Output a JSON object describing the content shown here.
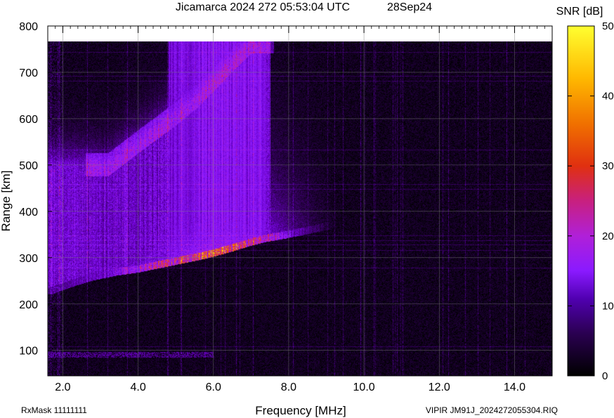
{
  "chart_data": {
    "type": "heatmap",
    "title": "Jicamarca 2024 272 05:53:04 UTC",
    "date_label": "28Sep24",
    "xlabel": "Frequency [MHz]",
    "ylabel": "Range [km]",
    "colorbar_label": "SNR [dB]",
    "xlim": [
      1.6,
      15.0
    ],
    "ylim": [
      45,
      800
    ],
    "x_ticks": [
      {
        "value": 2.0,
        "label": "2.0"
      },
      {
        "value": 4.0,
        "label": "4.0"
      },
      {
        "value": 6.0,
        "label": "6.0"
      },
      {
        "value": 8.0,
        "label": "8.0"
      },
      {
        "value": 10.0,
        "label": "10.0"
      },
      {
        "value": 12.0,
        "label": "12.0"
      },
      {
        "value": 14.0,
        "label": "14.0"
      }
    ],
    "y_ticks": [
      {
        "value": 100,
        "label": "100"
      },
      {
        "value": 200,
        "label": "200"
      },
      {
        "value": 300,
        "label": "300"
      },
      {
        "value": 400,
        "label": "400"
      },
      {
        "value": 500,
        "label": "500"
      },
      {
        "value": 600,
        "label": "600"
      },
      {
        "value": 700,
        "label": "700"
      },
      {
        "value": 800,
        "label": "800"
      }
    ],
    "colorbar_ticks": [
      {
        "value": 0,
        "label": "0"
      },
      {
        "value": 10,
        "label": "10"
      },
      {
        "value": 20,
        "label": "20"
      },
      {
        "value": 30,
        "label": "30"
      },
      {
        "value": 40,
        "label": "40"
      },
      {
        "value": 50,
        "label": "50"
      }
    ],
    "zlim": [
      0,
      50
    ],
    "data_top_range_km": 765,
    "grid": true,
    "traces": {
      "f_layer_o": [
        [
          1.7,
          225
        ],
        [
          2.2,
          240
        ],
        [
          2.8,
          255
        ],
        [
          3.4,
          265
        ],
        [
          4.0,
          272
        ],
        [
          4.6,
          282
        ],
        [
          5.2,
          292
        ],
        [
          5.8,
          302
        ],
        [
          6.4,
          315
        ],
        [
          7.0,
          330
        ],
        [
          7.4,
          338
        ],
        [
          7.9,
          345
        ],
        [
          8.5,
          355
        ],
        [
          9.1,
          365
        ]
      ],
      "f_layer_x": [
        [
          3.2,
          500
        ],
        [
          4.0,
          550
        ],
        [
          5.0,
          610
        ],
        [
          5.6,
          650
        ],
        [
          6.2,
          700
        ],
        [
          7.0,
          765
        ]
      ]
    },
    "peak_snr_db": 36,
    "colormap": [
      "#000000",
      "#3a0068",
      "#6a00c8",
      "#8a1aff",
      "#b020d8",
      "#d2206f",
      "#e8450a",
      "#f68d00",
      "#ffd000",
      "#ffff30"
    ]
  },
  "footer": {
    "rx_mask": "RxMask 11111111",
    "file": "VIPIR  JM91J_2024272055304.RIQ"
  }
}
